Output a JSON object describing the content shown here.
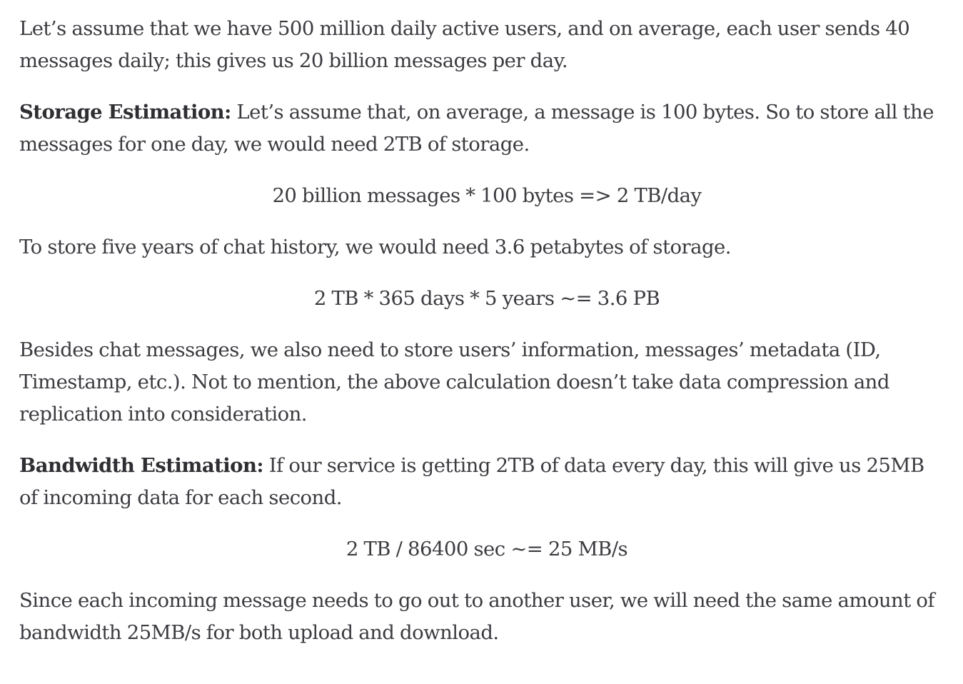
{
  "paragraphs": {
    "intro": "Let’s assume that we have 500 million daily active users, and on average, each user sends 40 messages daily; this gives us 20 billion messages per day.",
    "storage_label": "Storage Estimation:",
    "storage_text": " Let’s assume that, on average, a message is 100 bytes. So to store all the messages for one day, we would need 2TB of storage.",
    "formula_daily": "20 billion messages * 100 bytes => 2 TB/day",
    "five_years": "To store five years of chat history, we would need 3.6 petabytes of storage.",
    "formula_five_years": "2 TB * 365 days * 5 years ~= 3.6 PB",
    "besides": "Besides chat messages, we also need to store users’ information, messages’ metadata (ID, Timestamp, etc.). Not to mention, the above calculation doesn’t take data compression and replication into consideration.",
    "bandwidth_label": "Bandwidth Estimation:",
    "bandwidth_text": " If our service is getting 2TB of data every day, this will give us 25MB of incoming data for each second.",
    "formula_bandwidth": "2 TB / 86400 sec ~= 25 MB/s",
    "outro": "Since each incoming message needs to go out to another user, we will need the same amount of bandwidth 25MB/s for both upload and download."
  }
}
